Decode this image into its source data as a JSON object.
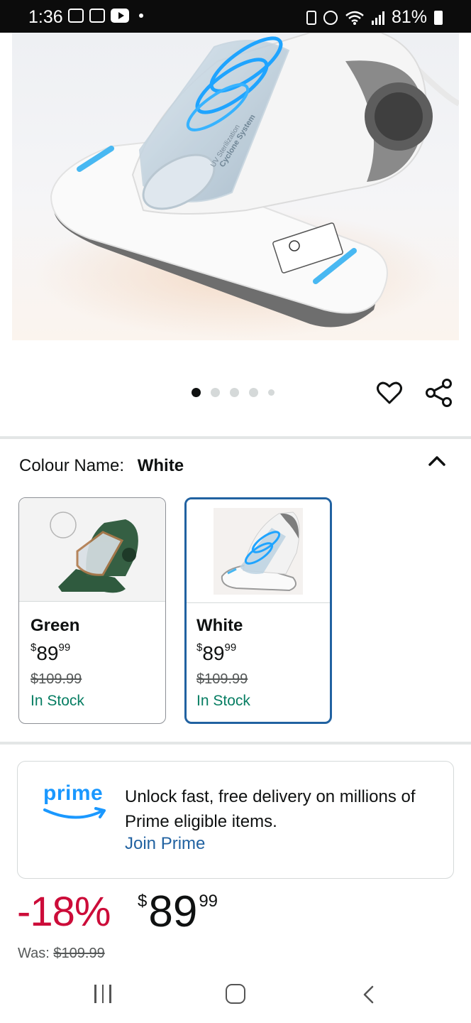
{
  "status_bar": {
    "time": "1:36",
    "battery": "81%",
    "icons": [
      "gallery-icon",
      "calendar-icon",
      "youtube-icon",
      "dot-icon",
      "battery-saver-icon",
      "alarm-icon",
      "wifi-icon",
      "signal-icon",
      "battery-icon"
    ]
  },
  "hero": {
    "product_image": "vacuum-white-main-image",
    "printed_text": [
      "UV Sterilization",
      "Cyclone System"
    ]
  },
  "carousel": {
    "total_dots": 5,
    "active_index": 0
  },
  "actions": {
    "favorite_icon": "heart-icon",
    "share_icon": "share-icon"
  },
  "colour": {
    "label": "Colour Name:",
    "selected": "White",
    "toggle_icon": "chevron-up-icon",
    "options": [
      {
        "name": "Green",
        "price_whole": "89",
        "price_currency": "$",
        "price_cents": "99",
        "was": "$109.99",
        "stock": "In Stock",
        "selected": false
      },
      {
        "name": "White",
        "price_whole": "89",
        "price_currency": "$",
        "price_cents": "99",
        "was": "$109.99",
        "stock": "In Stock",
        "selected": true
      }
    ]
  },
  "prime": {
    "logo_text": "prime",
    "message": "Unlock fast, free delivery on millions of Prime eligible items.",
    "link": "Join Prime"
  },
  "price": {
    "discount": "-18%",
    "currency": "$",
    "whole": "89",
    "cents": "99",
    "was_label": "Was:",
    "was_value": "$109.99"
  },
  "colors": {
    "deal_red": "#cc0c39",
    "stock_green": "#067d62",
    "link_blue": "#2162a1",
    "prime_blue": "#1a98ff",
    "selected_border": "#2162a1"
  },
  "nav_bar": {
    "icons": [
      "recent-apps-icon",
      "home-icon",
      "back-icon"
    ]
  }
}
